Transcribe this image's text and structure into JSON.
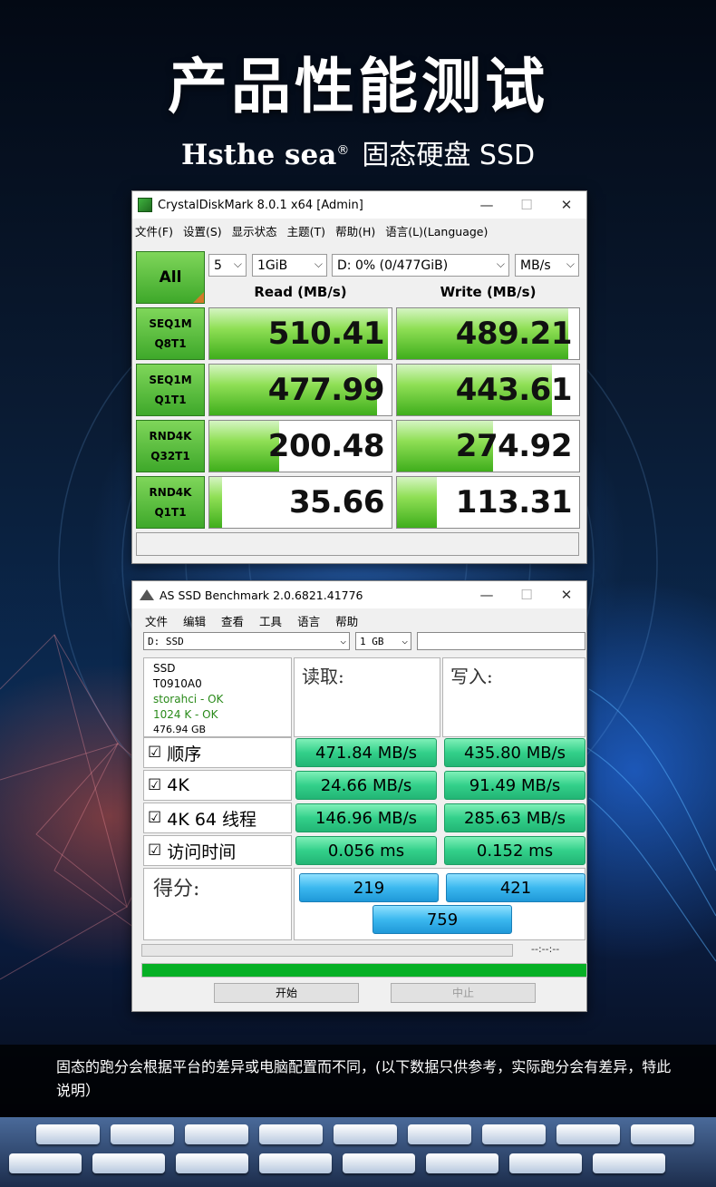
{
  "header": {
    "title": "产品性能测试",
    "brand_name": "Hsthe sea",
    "brand_mark": "®",
    "brand_rest": "固态硬盘 SSD"
  },
  "cdm": {
    "window_title": "CrystalDiskMark 8.0.1 x64 [Admin]",
    "menu": [
      "文件(F)",
      "设置(S)",
      "显示状态",
      "主题(T)",
      "帮助(H)",
      "语言(L)(Language)"
    ],
    "all_button": "All",
    "count_select": "5",
    "size_select": "1GiB",
    "drive_select": "D: 0% (0/477GiB)",
    "unit_select": "MB/s",
    "read_header": "Read (MB/s)",
    "write_header": "Write (MB/s)",
    "bar_scale_max": 520,
    "rows": [
      {
        "line1": "SEQ1M",
        "line2": "Q8T1",
        "read": "510.41",
        "write": "489.21",
        "read_val": 510.41,
        "write_val": 489.21
      },
      {
        "line1": "SEQ1M",
        "line2": "Q1T1",
        "read": "477.99",
        "write": "443.61",
        "read_val": 477.99,
        "write_val": 443.61
      },
      {
        "line1": "RND4K",
        "line2": "Q32T1",
        "read": "200.48",
        "write": "274.92",
        "read_val": 200.48,
        "write_val": 274.92
      },
      {
        "line1": "RND4K",
        "line2": "Q1T1",
        "read": "35.66",
        "write": "113.31",
        "read_val": 35.66,
        "write_val": 113.31
      }
    ],
    "accent_green": "#3ea82a"
  },
  "asssd": {
    "window_title": "AS SSD Benchmark 2.0.6821.41776",
    "menu": [
      "文件",
      "编辑",
      "查看",
      "工具",
      "语言",
      "帮助"
    ],
    "drive_select": "D:  SSD",
    "size_select": "1 GB",
    "info": {
      "model": "SSD",
      "firmware": "T0910A0",
      "driver": "storahci - OK",
      "alignment": "1024 K - OK",
      "capacity": "476.94 GB"
    },
    "read_header": "读取:",
    "write_header": "写入:",
    "tests": [
      {
        "label": "顺序",
        "read": "471.84 MB/s",
        "write": "435.80 MB/s"
      },
      {
        "label": "4K",
        "read": "24.66 MB/s",
        "write": "91.49 MB/s"
      },
      {
        "label": "4K 64 线程",
        "read": "146.96 MB/s",
        "write": "285.63 MB/s"
      },
      {
        "label": "访问时间",
        "read": "0.056 ms",
        "write": "0.152 ms"
      }
    ],
    "score_label": "得分:",
    "score_read": "219",
    "score_write": "421",
    "score_total": "759",
    "time_readout": "--:--:--",
    "progress": 1.0,
    "start_button": "开始",
    "abort_button": "中止",
    "ok_color": "#2a8a1a"
  },
  "footer": {
    "disclaimer": "固态的跑分会根据平台的差异或电脑配置而不同，(以下数据只供参考，实际跑分会有差异，特此说明）"
  }
}
